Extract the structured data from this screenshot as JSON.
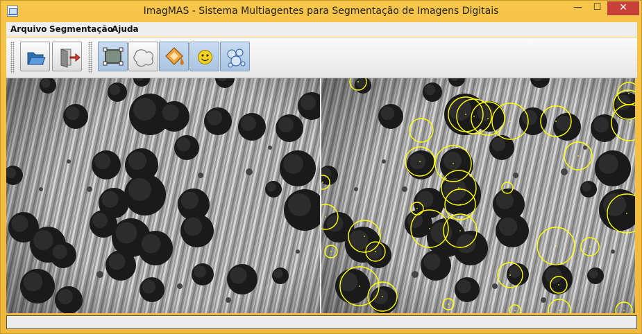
{
  "window": {
    "title": "ImagMAS - Sistema Multiagentes para Segmentação de Imagens Digitais",
    "controls": {
      "minimize": "—",
      "maximize": "☐",
      "close": "✕"
    },
    "frame_color": "#f5c243"
  },
  "menu": {
    "items": [
      {
        "label": "Arquivo"
      },
      {
        "label": "Segmentação"
      },
      {
        "label": "Ajuda"
      }
    ]
  },
  "toolbar": {
    "buttons": [
      {
        "icon": "folder-open-icon",
        "selected": false
      },
      {
        "icon": "exit-door-icon",
        "selected": false
      },
      {
        "icon": "region-select-icon",
        "selected": true
      },
      {
        "icon": "blob-outline-icon",
        "selected": false
      },
      {
        "icon": "paint-bucket-icon",
        "selected": true
      },
      {
        "icon": "smiley-icon",
        "selected": true
      },
      {
        "icon": "bubbles-icon",
        "selected": true
      }
    ]
  },
  "images": {
    "left": {
      "content": "grayscale micrograph with dark circular particles"
    },
    "right": {
      "content": "segmented micrograph with yellow circle detections",
      "overlay_color": "#ffff00"
    }
  },
  "status": {
    "text": ""
  }
}
